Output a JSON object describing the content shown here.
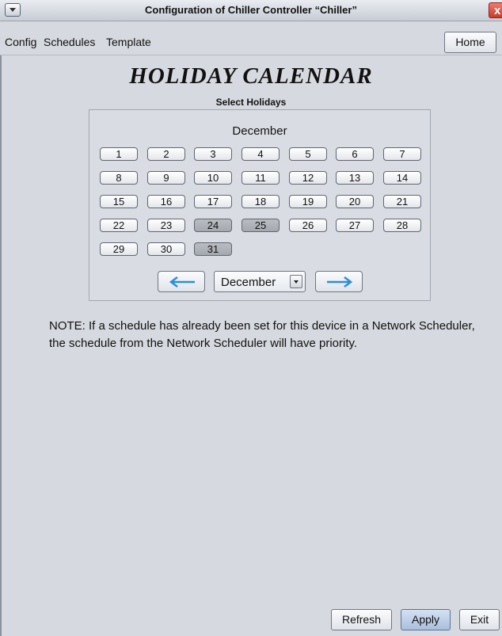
{
  "window": {
    "title": "Configuration of Chiller Controller “Chiller”",
    "close_label": "x"
  },
  "menubar": {
    "items": [
      "Config",
      "Schedules",
      "Template"
    ],
    "home_label": "Home"
  },
  "page": {
    "heading": "HOLIDAY CALENDAR",
    "subheading": "Select Holidays"
  },
  "calendar": {
    "month_title": "December",
    "days": [
      "1",
      "2",
      "3",
      "4",
      "5",
      "6",
      "7",
      "8",
      "9",
      "10",
      "11",
      "12",
      "13",
      "14",
      "15",
      "16",
      "17",
      "18",
      "19",
      "20",
      "21",
      "22",
      "23",
      "24",
      "25",
      "26",
      "27",
      "28",
      "29",
      "30",
      "31"
    ],
    "selected_days": [
      "24",
      "25",
      "31"
    ],
    "month_select": "December",
    "prev_icon": "arrow-left-icon",
    "next_icon": "arrow-right-icon",
    "arrow_color": "#2a8fd8"
  },
  "note": "NOTE: If a schedule has already been set for this device in a Network Scheduler, the schedule from the Network Scheduler will have priority.",
  "footer": {
    "refresh_label": "Refresh",
    "apply_label": "Apply",
    "exit_label": "Exit"
  }
}
